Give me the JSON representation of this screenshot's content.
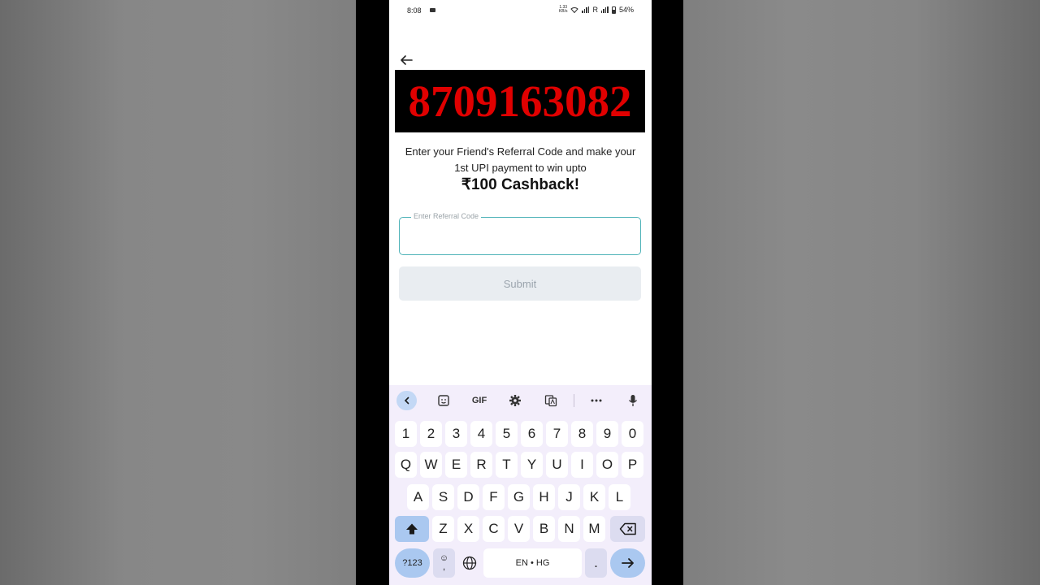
{
  "status_bar": {
    "time": "8:08",
    "net_speed_value": "1.33",
    "net_speed_unit": "KB/s",
    "roaming": "R",
    "battery": "54%"
  },
  "banner": {
    "phone_number": "8709163082",
    "color": "#e00000"
  },
  "description": {
    "line1": "Enter your Friend's Referral Code and make your",
    "line2": "1st UPI payment to win upto"
  },
  "cashback": "₹100 Cashback!",
  "referral_field": {
    "label": "Enter Referral Code",
    "value": ""
  },
  "submit_label": "Submit",
  "keyboard": {
    "toolbar": {
      "gif": "GIF"
    },
    "numbers": [
      "1",
      "2",
      "3",
      "4",
      "5",
      "6",
      "7",
      "8",
      "9",
      "0"
    ],
    "row1": [
      "Q",
      "W",
      "E",
      "R",
      "T",
      "Y",
      "U",
      "I",
      "O",
      "P"
    ],
    "row2": [
      "A",
      "S",
      "D",
      "F",
      "G",
      "H",
      "J",
      "K",
      "L"
    ],
    "row3": [
      "Z",
      "X",
      "C",
      "V",
      "B",
      "N",
      "M"
    ],
    "symbols_label": "?123",
    "emoji_label": "☺",
    "comma_label": ",",
    "space_label": "EN • HG",
    "period_label": "."
  }
}
